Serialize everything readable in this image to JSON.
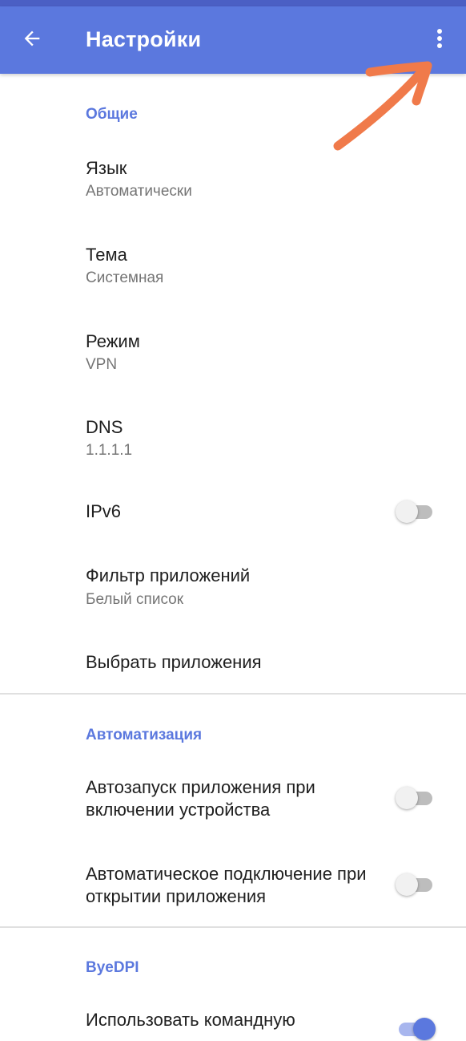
{
  "app_bar": {
    "title": "Настройки",
    "back_icon": "arrow-back-icon",
    "menu_icon": "more-vert-icon",
    "color": "#5b78de"
  },
  "sections": {
    "general": {
      "header": "Общие",
      "language": {
        "title": "Язык",
        "summary": "Автоматически"
      },
      "theme": {
        "title": "Тема",
        "summary": "Системная"
      },
      "mode": {
        "title": "Режим",
        "summary": "VPN"
      },
      "dns": {
        "title": "DNS",
        "summary": "1.1.1.1"
      },
      "ipv6": {
        "title": "IPv6",
        "enabled": false
      },
      "app_filter": {
        "title": "Фильтр приложений",
        "summary": "Белый список"
      },
      "select_apps": {
        "title": "Выбрать приложения"
      }
    },
    "automation": {
      "header": "Автоматизация",
      "autostart": {
        "title": "Автозапуск приложения при включении устройства",
        "enabled": false
      },
      "autoconnect": {
        "title": "Автоматическое подключение при открытии приложения",
        "enabled": false
      }
    },
    "byedpi": {
      "header": "ByeDPI",
      "cmd": {
        "title": "Использовать командную",
        "enabled": true
      }
    }
  },
  "colors": {
    "accent": "#5b78de",
    "annotation_arrow": "#f07a4a"
  }
}
